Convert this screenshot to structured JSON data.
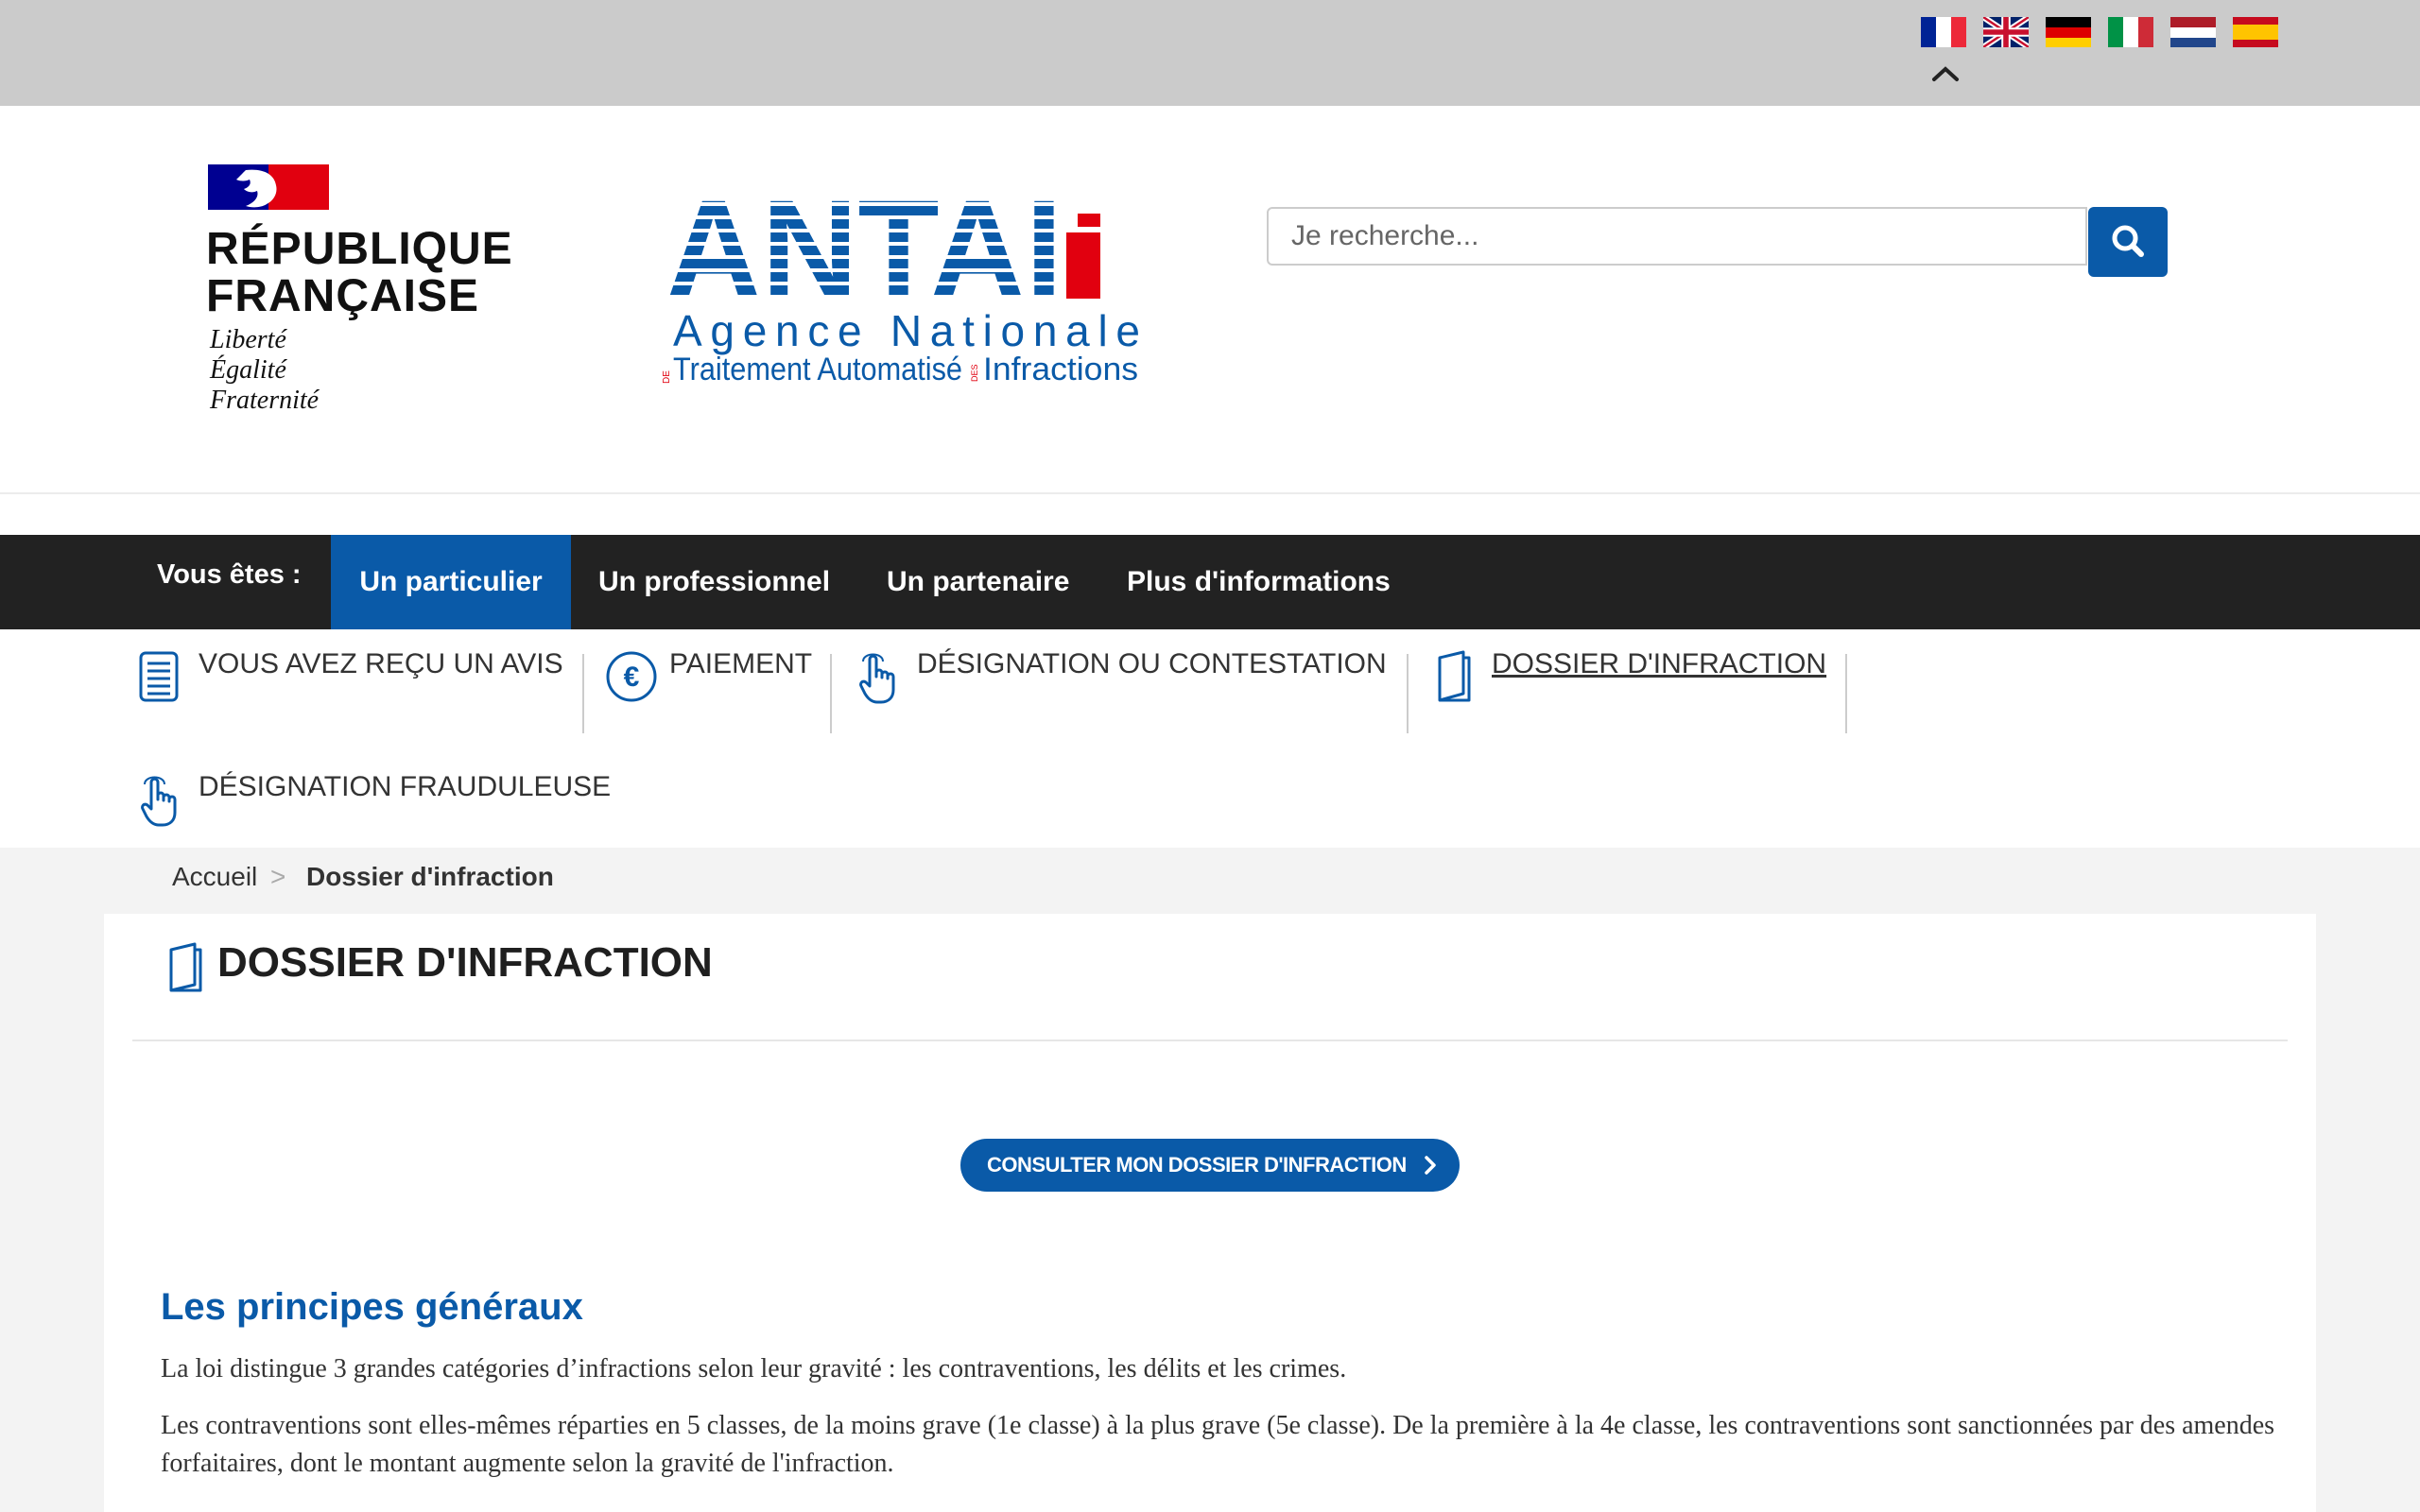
{
  "languages": [
    {
      "code": "fr",
      "name": "Français"
    },
    {
      "code": "en",
      "name": "English"
    },
    {
      "code": "de",
      "name": "Deutsch"
    },
    {
      "code": "it",
      "name": "Italiano"
    },
    {
      "code": "nl",
      "name": "Nederlands"
    },
    {
      "code": "es",
      "name": "Español"
    }
  ],
  "header": {
    "republique": {
      "line1": "RÉPUBLIQUE",
      "line2": "FRANÇAISE",
      "motto": [
        "Liberté",
        "Égalité",
        "Fraternité"
      ]
    },
    "antai": {
      "acronym": "ANTAI",
      "line1": "Agence Nationale",
      "line2_a": "Traitement Automatisé",
      "line2_b": "Infractions",
      "small_de": "DE",
      "small_des": "DES"
    },
    "search": {
      "placeholder": "Je recherche...",
      "button_icon": "search-icon"
    }
  },
  "nav": {
    "label": "Vous êtes :",
    "tabs": [
      "Un particulier",
      "Un professionnel",
      "Un partenaire",
      "Plus d'informations"
    ],
    "active_index": 0
  },
  "submenu": [
    {
      "label": "VOUS AVEZ REÇU UN AVIS",
      "icon": "document-icon"
    },
    {
      "label": "PAIEMENT",
      "icon": "euro-icon"
    },
    {
      "label": "DÉSIGNATION OU CONTESTATION",
      "icon": "hand-pointer-icon"
    },
    {
      "label": "DOSSIER D'INFRACTION",
      "icon": "book-icon",
      "current": true
    },
    {
      "label": "DÉSIGNATION FRAUDULEUSE",
      "icon": "hand-pointer-icon"
    }
  ],
  "breadcrumb": {
    "home": "Accueil",
    "separator": ">",
    "current": "Dossier d'infraction"
  },
  "main": {
    "title": "DOSSIER D'INFRACTION",
    "cta": "CONSULTER MON DOSSIER D'INFRACTION",
    "section_title": "Les principes généraux",
    "paragraphs": [
      "La loi distingue 3 grandes catégories d’infractions selon leur gravité : les contraventions, les délits et les crimes.",
      "Les contraventions sont elles-mêmes réparties en 5 classes, de la moins grave (1e classe) à la plus grave (5e classe). De la première à la 4e classe, les contraventions sont sanctionnées par des amendes forfaitaires, dont le montant augmente selon la gravité de l'infraction."
    ]
  },
  "colors": {
    "primary": "#0a5aa8",
    "nav_bg": "#222222",
    "topbar": "#cbcbcb",
    "rf_red": "#e1000f",
    "rf_blue": "#000091"
  }
}
